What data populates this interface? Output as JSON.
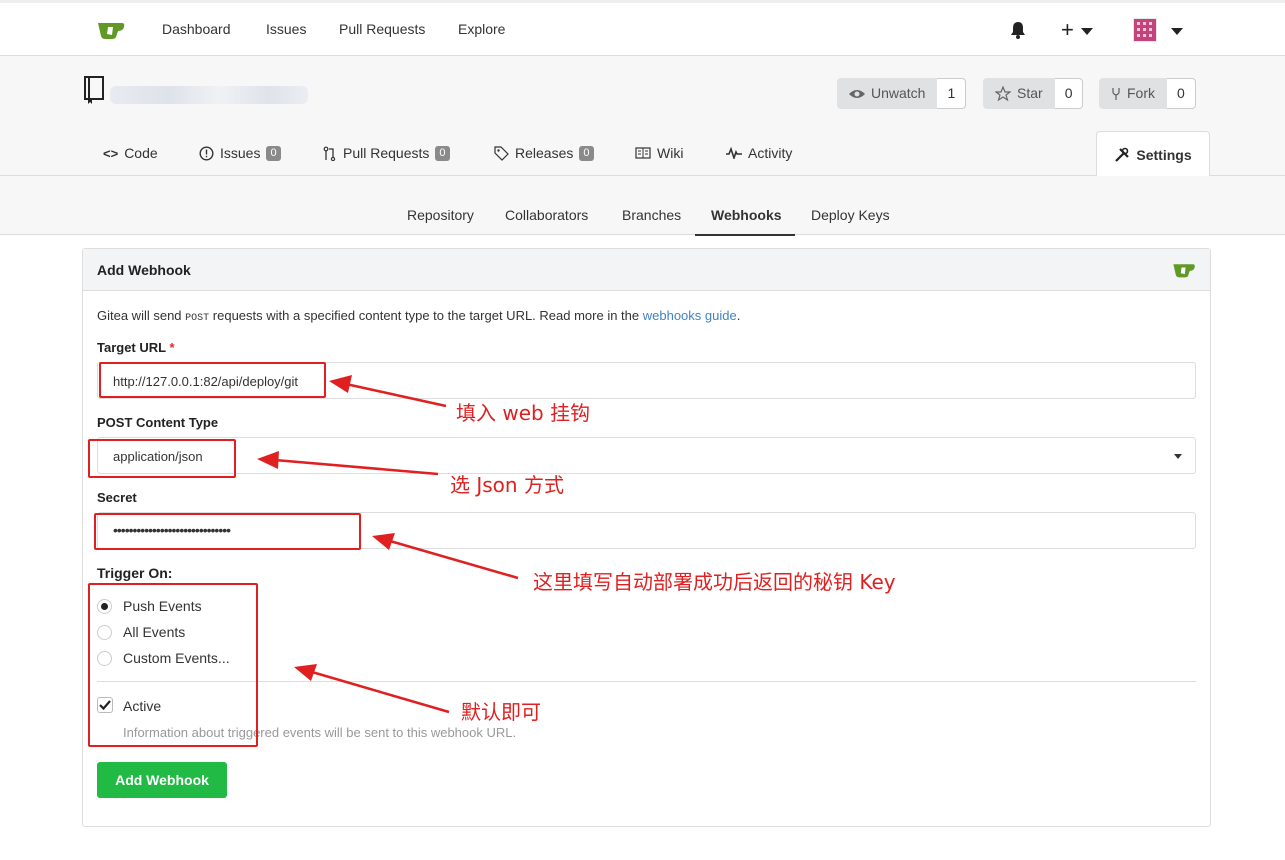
{
  "nav": {
    "items": [
      "Dashboard",
      "Issues",
      "Pull Requests",
      "Explore"
    ],
    "plus": "+"
  },
  "repo": {
    "unwatch_label": "Unwatch",
    "unwatch_count": "1",
    "star_label": "Star",
    "star_count": "0",
    "fork_label": "Fork",
    "fork_count": "0"
  },
  "tabs": {
    "code": "Code",
    "issues": "Issues",
    "issues_count": "0",
    "pulls": "Pull Requests",
    "pulls_count": "0",
    "releases": "Releases",
    "releases_count": "0",
    "wiki": "Wiki",
    "activity": "Activity",
    "settings": "Settings"
  },
  "subnav": [
    "Repository",
    "Collaborators",
    "Branches",
    "Webhooks",
    "Deploy Keys"
  ],
  "form": {
    "title": "Add Webhook",
    "desc_pre": "Gitea will send ",
    "desc_post": "POST",
    "desc_mid": " requests with a specified content type to the target URL. Read more in the ",
    "desc_link": "webhooks guide",
    "desc_end": ".",
    "target_label": "Target URL",
    "required_mark": "*",
    "target_value": "http://127.0.0.1:82/api/deploy/git",
    "content_type_label": "POST Content Type",
    "content_type_value": "application/json",
    "secret_label": "Secret",
    "secret_value": "••••••••••••••••••••••••••••••",
    "trigger_label": "Trigger On:",
    "trigger_options": [
      "Push Events",
      "All Events",
      "Custom Events..."
    ],
    "active_label": "Active",
    "active_desc": "Information about triggered events will be sent to this webhook URL.",
    "submit": "Add Webhook"
  },
  "annotations": {
    "a1": "填入 web 挂钩",
    "a2": "选 Json 方式",
    "a3": "这里填写自动部署成功后返回的秘钥 Key",
    "a4": "默认即可"
  },
  "colors": {
    "accent": "#21ba45",
    "link": "#4183c4",
    "annotation": "#e02020"
  }
}
